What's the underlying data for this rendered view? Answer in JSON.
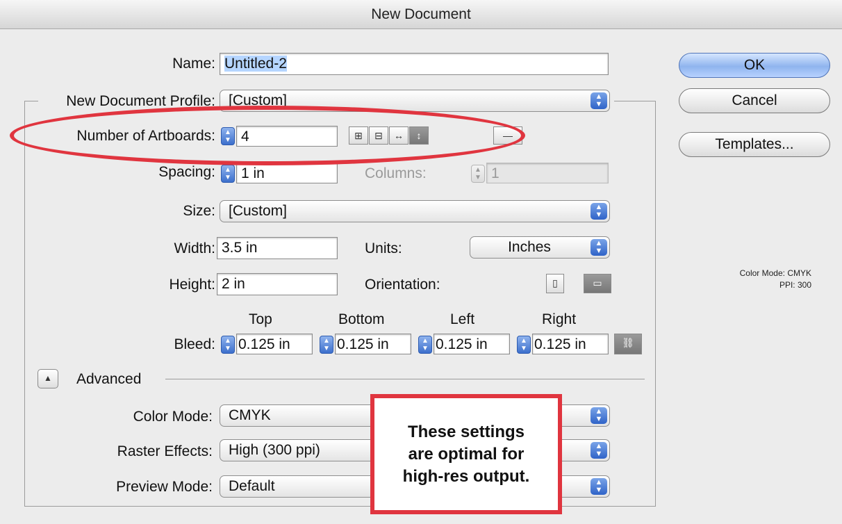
{
  "dialog": {
    "title": "New Document"
  },
  "name": {
    "label": "Name:",
    "value": "Untitled-2"
  },
  "profile": {
    "label": "New Document Profile:",
    "value": "[Custom]"
  },
  "artboards": {
    "label": "Number of Artboards:",
    "value": "4"
  },
  "spacing": {
    "label": "Spacing:",
    "value": "1 in"
  },
  "columns": {
    "label": "Columns:",
    "value": "1"
  },
  "size": {
    "label": "Size:",
    "value": "[Custom]"
  },
  "width": {
    "label": "Width:",
    "value": "3.5 in"
  },
  "units": {
    "label": "Units:",
    "value": "Inches"
  },
  "height": {
    "label": "Height:",
    "value": "2 in"
  },
  "orientation": {
    "label": "Orientation:"
  },
  "bleed": {
    "label": "Bleed:",
    "headers": [
      "Top",
      "Bottom",
      "Left",
      "Right"
    ],
    "values": [
      "0.125 in",
      "0.125 in",
      "0.125 in",
      "0.125 in"
    ]
  },
  "advanced": {
    "label": "Advanced"
  },
  "color_mode": {
    "label": "Color Mode:",
    "value": "CMYK"
  },
  "raster_effects": {
    "label": "Raster Effects:",
    "value": "High (300 ppi)"
  },
  "preview_mode": {
    "label": "Preview Mode:",
    "value": "Default"
  },
  "buttons": {
    "ok": "OK",
    "cancel": "Cancel",
    "templates": "Templates..."
  },
  "info": {
    "color_mode": "Color Mode: CMYK",
    "ppi": "PPI: 300"
  },
  "callout": {
    "lines": [
      "These settings",
      "are optimal for",
      "high-res output."
    ]
  },
  "colors": {
    "highlight_red": "#e0353f",
    "accent_blue": "#3c6fcc"
  }
}
